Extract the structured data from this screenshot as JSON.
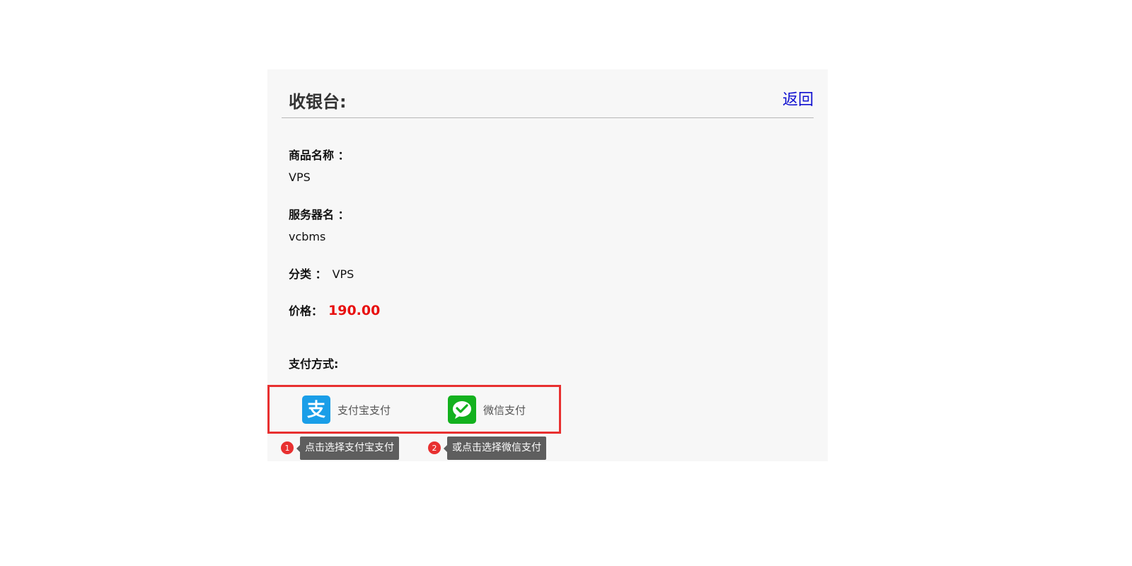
{
  "header": {
    "title": "收银台:",
    "back_label": "返回"
  },
  "order": {
    "product_label": "商品名称 ：",
    "product_value": "VPS",
    "server_label": "服务器名 ：",
    "server_value": "vcbms",
    "category_label": "分类 ：",
    "category_value": "VPS",
    "price_label": "价格：",
    "price_value": "190.00"
  },
  "payment": {
    "label": "支付方式:",
    "options": [
      {
        "name": "支付宝支付",
        "icon": "alipay-icon"
      },
      {
        "name": "微信支付",
        "icon": "wechat-pay-icon"
      }
    ],
    "tips": [
      {
        "number": "1",
        "text": "点击选择支付宝支付"
      },
      {
        "number": "2",
        "text": "或点击选择微信支付"
      }
    ]
  },
  "colors": {
    "price": "#e81010",
    "link": "#1010d0",
    "highlight_border": "#e83030",
    "alipay": "#1a9ee8",
    "wechat": "#13b11e",
    "tip_bg": "#5e5e5e"
  }
}
